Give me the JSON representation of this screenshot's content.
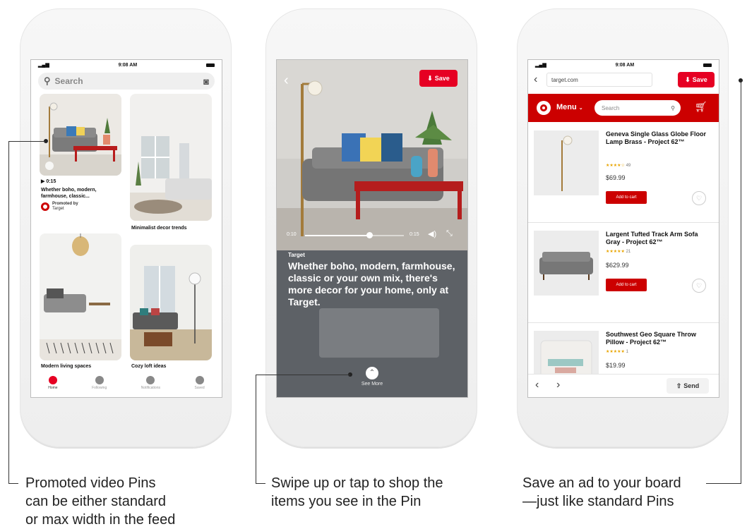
{
  "phone1": {
    "status_time": "9:08 AM",
    "search_placeholder": "Search",
    "pin1": {
      "duration": "0:15",
      "title": "Whether boho, modern, farmhouse, classic...",
      "promoted_label": "Promoted by",
      "promoted_by": "Target"
    },
    "pin2": {
      "title": "Minimalist decor trends"
    },
    "pin3": {
      "title": "Modern living spaces"
    },
    "pin4": {
      "title": "Cozy loft ideas"
    },
    "nav": [
      "Home",
      "Following",
      "Notifications",
      "Saved"
    ]
  },
  "phone2": {
    "save_label": "Save",
    "time_elapsed": "0:10",
    "time_total": "0:15",
    "advertiser": "Target",
    "headline": "Whether boho, modern, farmhouse, classic or your own mix, there's more decor for your home, only at Target.",
    "see_more": "See More"
  },
  "phone3": {
    "status_time": "9:08 AM",
    "url": "target.com",
    "save_label": "Save",
    "menu_label": "Menu",
    "search_placeholder": "Search",
    "products": [
      {
        "name": "Geneva Single Glass Globe Floor Lamp Brass - Project 62™",
        "rating_count": "49",
        "price": "$69.99",
        "cart": "Add to cart"
      },
      {
        "name": "Largent Tufted Track Arm Sofa Gray - Project 62™",
        "rating_count": "21",
        "price": "$629.99",
        "cart": "Add to cart"
      },
      {
        "name": "Southwest Geo Square Throw Pillow - Project 62™",
        "rating_count": "1",
        "price": "$19.99"
      }
    ],
    "send_label": "Send"
  },
  "captions": {
    "left": [
      "Promoted video Pins",
      "can be either standard",
      "or max width in the feed"
    ],
    "middle": [
      "Swipe up or tap to shop the",
      "items you see in the Pin"
    ],
    "right": [
      "Save an ad to your board",
      "—just like standard Pins"
    ]
  },
  "colors": {
    "pinterest_red": "#e60023",
    "target_red": "#cc0000",
    "rating": "#e8a400"
  },
  "icons": [
    "search-icon",
    "camera-icon",
    "back-icon",
    "pin-icon",
    "play-icon",
    "volume-icon",
    "expand-icon",
    "chevron-up-icon",
    "cart-icon",
    "heart-icon",
    "send-icon",
    "target-logo"
  ]
}
